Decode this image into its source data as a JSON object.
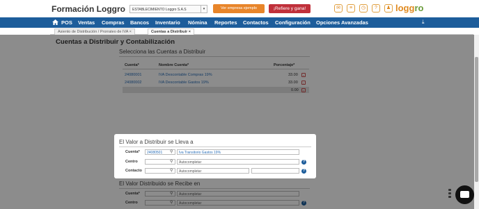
{
  "app": {
    "title": "Formación Loggro",
    "company_selector": "ESTABLECIMIENTO Loggro S.A.S",
    "demo_button": "Ver empresa ejemplo",
    "refer_button": "¡Refiere y gana!",
    "logo_main": "logg",
    "logo_accent": "ro"
  },
  "nav": {
    "items": [
      "POS",
      "Ventas",
      "Compras",
      "Bancos",
      "Inventario",
      "Nómina",
      "Reportes",
      "Contactos",
      "Configuración",
      "Opciones Avanzadas"
    ]
  },
  "tabs": [
    {
      "label": "Asiento de Distribución / Prorrateo de IVA"
    },
    {
      "label": "Cuentas a Distribuir"
    }
  ],
  "page": {
    "title": "Cuentas a Distribuir y Contabilización",
    "section1_title": "Selecciona las Cuentas a Distribuir"
  },
  "table": {
    "headers": [
      "Cuenta*",
      "Nombre Cuenta*",
      "Porcentaje*"
    ],
    "rows": [
      {
        "cuenta": "24080001",
        "nombre": "IVA Descontable Compras 19%",
        "porcentaje": "33.00"
      },
      {
        "cuenta": "24080002",
        "nombre": "IVA Descontable Gastos 19%",
        "porcentaje": "33.00"
      }
    ],
    "total": "0.00"
  },
  "modal": {
    "title": "El Valor a Distribuir se Lleva a",
    "cuenta_label": "Cuenta*",
    "cuenta_code": "24080501",
    "cuenta_name": "Iva Transitorio Gastos 19%",
    "centro_label": "Centro",
    "centro_placeholder": "Autocompletar",
    "contacto_label": "Contacto",
    "contacto_placeholder": "Autocompletar"
  },
  "section2": {
    "title": "El Valor Distribuido se Recibe en",
    "cuenta_label": "Cuenta*",
    "cuenta_placeholder": "Autocompletar",
    "centro_label": "Centro",
    "centro_placeholder": "Autocompletar"
  },
  "colors": {
    "nav_bg": "#1d5d9b",
    "orange": "#e8852a",
    "red": "#c0303a",
    "link": "#2b6fb8"
  }
}
